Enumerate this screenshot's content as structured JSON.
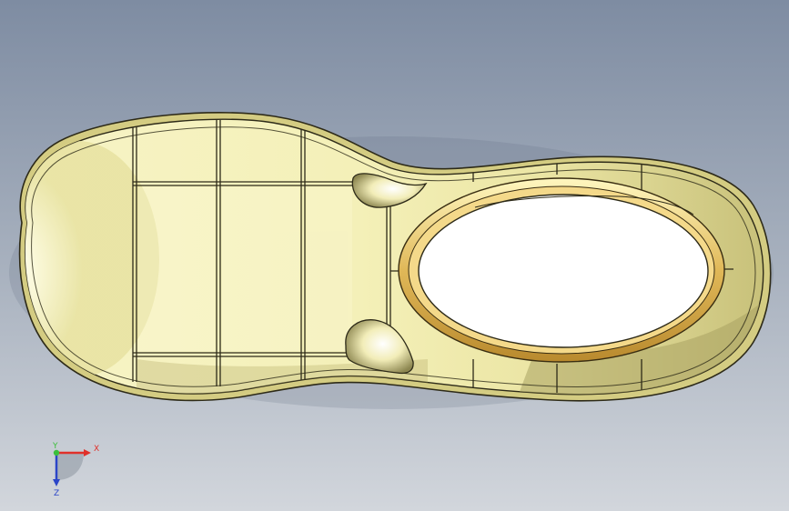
{
  "viewport": {
    "background_top": "#7f8da3",
    "background_bottom": "#ced3d9",
    "model_color": "#f3efb4",
    "model_edge_color": "#2d2a18"
  },
  "triad": {
    "x_label": "X",
    "y_label": "Y",
    "z_label": "Z",
    "x_color": "#e0302a",
    "y_color": "#3bbf3b",
    "z_color": "#2b45c8"
  }
}
